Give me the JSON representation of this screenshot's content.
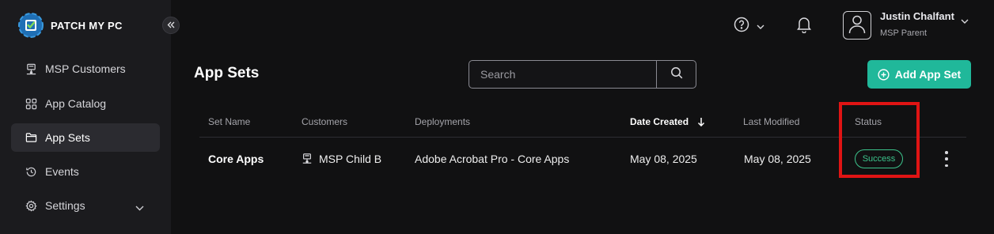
{
  "brand": {
    "name": "PATCH MY PC"
  },
  "sidebar": {
    "items": [
      {
        "label": "MSP Customers",
        "icon": "network-icon"
      },
      {
        "label": "App Catalog",
        "icon": "grid-icon"
      },
      {
        "label": "App Sets",
        "icon": "folder-icon",
        "active": true
      },
      {
        "label": "Events",
        "icon": "history-icon"
      },
      {
        "label": "Settings",
        "icon": "gear-icon"
      }
    ]
  },
  "header": {
    "user_name": "Justin Chalfant",
    "user_role": "MSP Parent"
  },
  "main": {
    "title": "App Sets",
    "search_placeholder": "Search",
    "add_button_label": "Add App Set",
    "table": {
      "columns": [
        "Set Name",
        "Customers",
        "Deployments",
        "Date Created",
        "Last Modified",
        "Status"
      ],
      "sorted_column": "Date Created",
      "sort_direction": "descending",
      "rows": [
        {
          "set_name": "Core Apps",
          "customer": "MSP Child B",
          "deployment": "Adobe Acrobat Pro - Core Apps",
          "date_created": "May 08, 2025",
          "last_modified": "May 08, 2025",
          "status": "Success"
        }
      ]
    }
  },
  "colors": {
    "accent": "#20b89a",
    "success": "#3cc48c",
    "highlight": "#e01414",
    "sidebar_bg": "#1b1b1e",
    "page_bg": "#111112"
  }
}
